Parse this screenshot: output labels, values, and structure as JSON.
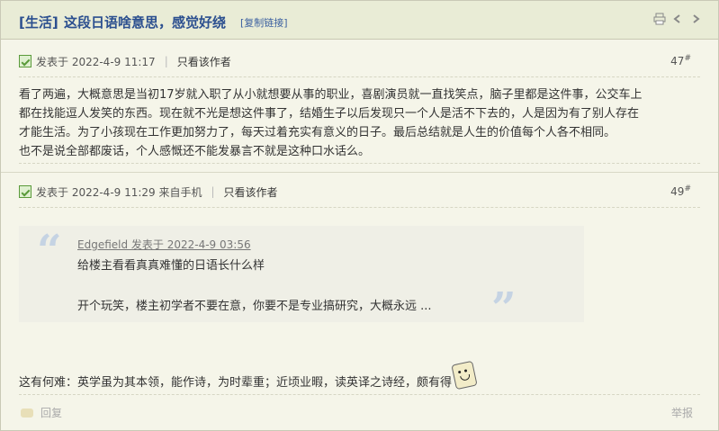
{
  "thread": {
    "tag": "[生活]",
    "title": "这段日语啥意思，感觉好绕",
    "copy_link": "[复制链接]"
  },
  "toolbar_icons": [
    "print-icon",
    "prev-icon",
    "next-icon"
  ],
  "posts": [
    {
      "meta_posted": "发表于 2022-4-9 11:17",
      "only_author": "只看该作者",
      "floor": "47",
      "floor_sup": "#",
      "lines": [
        "看了两遍，大概意思是当初17岁就入职了从小就想要从事的职业，喜剧演员就一直找笑点，脑子里都是这件事，公交车上",
        "都在找能逗人发笑的东西。现在就不光是想这件事了，结婚生子以后发现只一个人是活不下去的，人是因为有了别人存在",
        "才能生活。为了小孩现在工作更加努力了，每天过着充实有意义的日子。最后总结就是人生的价值每个人各不相同。",
        "也不是说全部都废话，个人感慨还不能发暴言不就是这种口水话么。"
      ]
    },
    {
      "meta_posted": "发表于 2022-4-9 11:29 来自手机",
      "only_author": "只看该作者",
      "floor": "49",
      "floor_sup": "#",
      "quote": {
        "author": "Edgefield 发表于 2022-4-9 03:56",
        "line1": "给楼主看看真真难懂的日语长什么样",
        "line2": "开个玩笑，楼主初学者不要在意，你要不是专业搞研究，大概永远 ..."
      },
      "body": "这有何难：英学虽为其本领，能作诗，为时辈重；近顷业暇，读英译之诗经，颇有得"
    }
  ],
  "footer": {
    "reply": "回复",
    "report": "举报"
  }
}
